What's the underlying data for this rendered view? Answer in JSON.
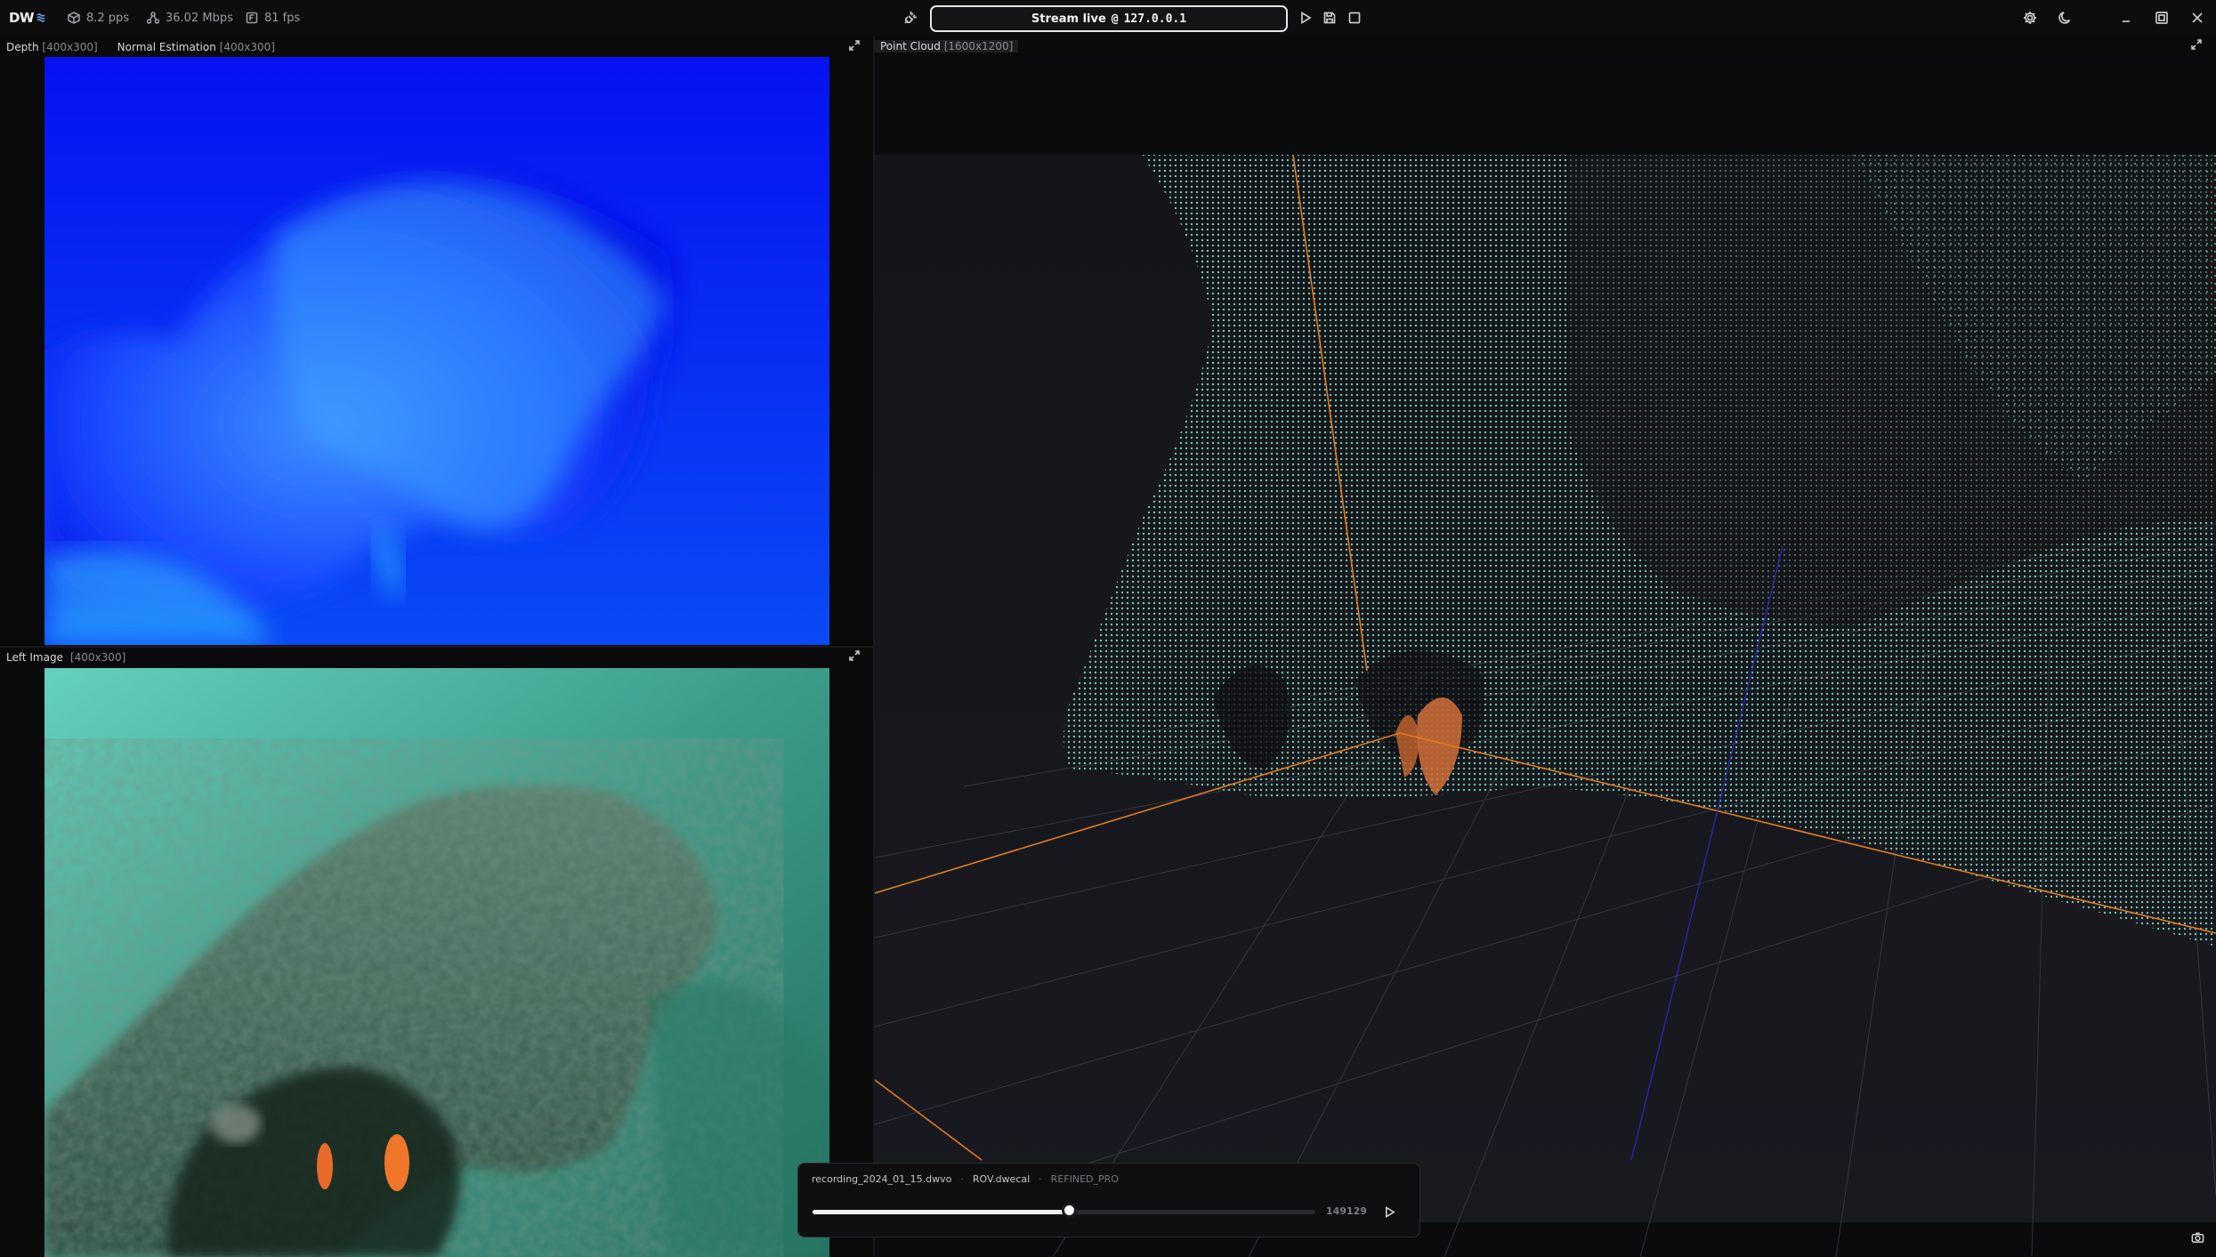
{
  "app": {
    "logo_text": "DW",
    "stats": {
      "pps": "8.2 pps",
      "bandwidth": "36.02 Mbps",
      "fps": "81 fps"
    }
  },
  "stream": {
    "status_label": "Stream live",
    "separator": "@",
    "address": "127.0.0.1"
  },
  "icons": {
    "logo_wave": "wave-icon",
    "pps": "cube-icon",
    "bandwidth": "network-icon",
    "fps": "fps-icon",
    "disconnect": "plug-icon",
    "play": "play-icon",
    "save": "save-icon",
    "stop": "stop-icon",
    "settings": "gear-icon",
    "theme": "moon-icon",
    "minimize": "minimize-icon",
    "maximize": "maximize-icon",
    "close": "close-icon",
    "expand": "expand-icon",
    "corner": "camera-icon"
  },
  "panels": {
    "depth": {
      "tab1_label": "Depth",
      "tab1_res": "[400x300]",
      "tab2_label": "Normal Estimation",
      "tab2_res": "[400x300]"
    },
    "left_image": {
      "label": "Left Image",
      "res": "[400x300]"
    },
    "point_cloud": {
      "label": "Point Cloud",
      "res": "[1600x1200]"
    }
  },
  "player": {
    "recording": "recording_2024_01_15.dwvo",
    "calibration": "ROV.dwecal",
    "mode": "REFINED_PRO",
    "frame": "149129",
    "progress": 0.51
  },
  "colors": {
    "accent_pointcloud": "#6fc7a9",
    "axis_orange": "#e07b1d",
    "axis_blue": "#2a2ad0",
    "depth_blue": "#0a20ff"
  }
}
